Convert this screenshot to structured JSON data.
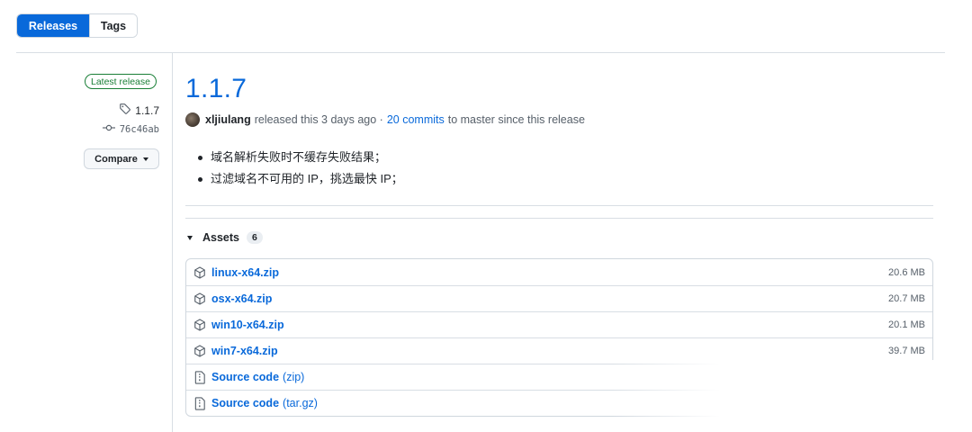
{
  "tabs": {
    "releases": "Releases",
    "tags": "Tags"
  },
  "sidebar": {
    "latest_badge": "Latest release",
    "tag": "1.1.7",
    "commit": "76c46ab",
    "compare_label": "Compare"
  },
  "release": {
    "title": "1.1.7",
    "author": "xljiulang",
    "released_text": "released this 3 days ago ·",
    "commits_link": "20 commits",
    "commits_suffix": "to master since this release",
    "notes": [
      "域名解析失败时不缓存失败结果；",
      "过滤域名不可用的 IP，挑选最快 IP；"
    ]
  },
  "assets": {
    "label": "Assets",
    "count": "6",
    "files": [
      {
        "name": "linux-x64.zip",
        "size": "20.6 MB"
      },
      {
        "name": "osx-x64.zip",
        "size": "20.7 MB"
      },
      {
        "name": "win10-x64.zip",
        "size": "20.1 MB"
      },
      {
        "name": "win7-x64.zip",
        "size": "39.7 MB"
      }
    ],
    "source": [
      {
        "name": "Source code",
        "ext": "(zip)"
      },
      {
        "name": "Source code",
        "ext": "(tar.gz)"
      }
    ]
  },
  "colors": {
    "accent": "#0969da",
    "success": "#1a7f37",
    "border": "#d0d7de"
  }
}
